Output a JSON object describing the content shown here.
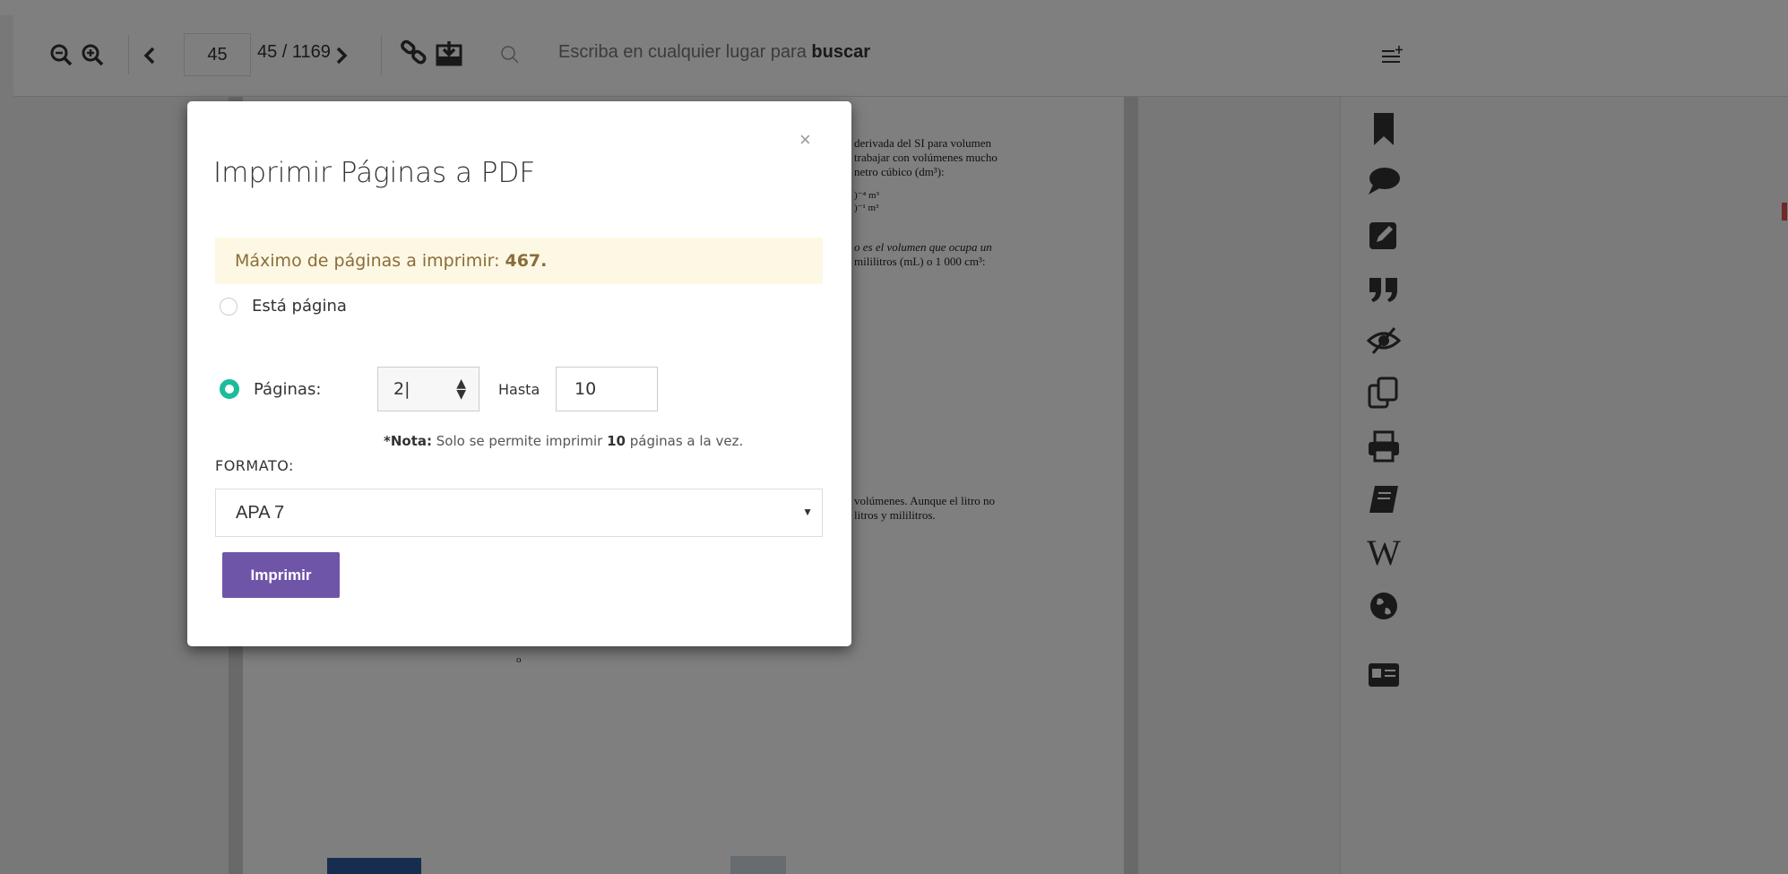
{
  "toolbar": {
    "page_input": "45",
    "page_total": "45 / 1169",
    "search_placeholder_prefix": "Escriba en cualquier lugar para",
    "search_placeholder_bold": "buscar"
  },
  "document": {
    "lines": [
      "derivada del SI para volumen",
      "trabajar con volúmenes mucho",
      "netro cúbico (dm³):",
      ")⁻⁴ m³",
      ")⁻¹ m³",
      "o es el volumen que ocupa un",
      "mililitros (mL) o 1 000 cm³:",
      "volúmenes. Aunque el litro no",
      "litros y mililitros.",
      "o"
    ]
  },
  "modal": {
    "title": "Imprimir Páginas a PDF",
    "close": "×",
    "alert_text": "Máximo de páginas a imprimir:",
    "alert_max": "467.",
    "option_this_page": "Está página",
    "option_pages": "Páginas:",
    "from_value": "2|",
    "hasta_label": "Hasta",
    "to_value": "10",
    "note_prefix": "*Nota:",
    "note_text1": "Solo se permite imprimir",
    "note_count": "10",
    "note_text2": "páginas a la vez.",
    "formato_label": "FORMATO:",
    "format_selected": "APA 7",
    "print_button": "Imprimir"
  },
  "sidebar": {
    "icons": [
      "bookmark-icon",
      "comment-icon",
      "edit-icon",
      "quote-icon",
      "hide-icon",
      "copy-icon",
      "print-icon",
      "book-icon",
      "wikipedia-icon",
      "globe-icon",
      "id-card-icon"
    ]
  },
  "colors": {
    "accent_purple": "#6f55a8",
    "radio_teal": "#1abc9c",
    "alert_bg": "#fcf8e3",
    "alert_text": "#8a6d3b"
  }
}
